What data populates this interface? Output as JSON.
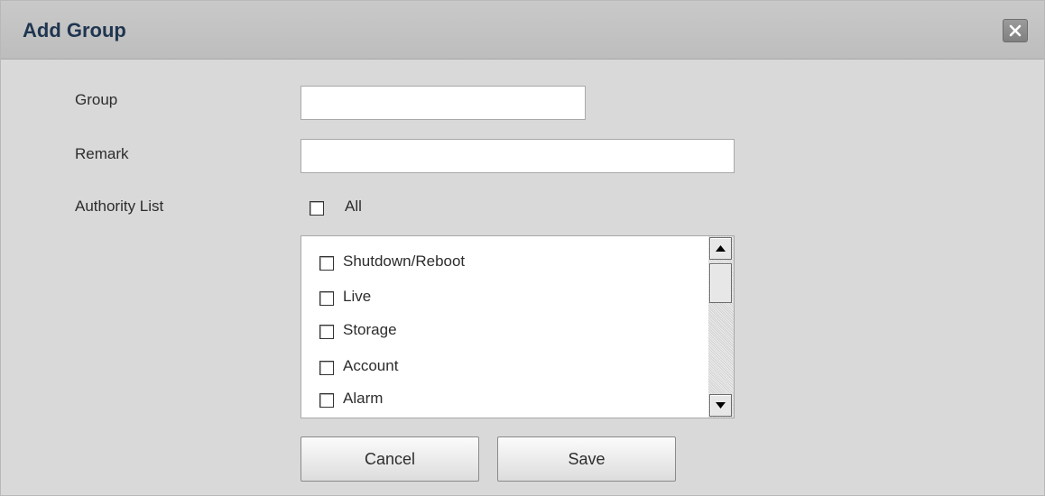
{
  "dialog": {
    "title": "Add Group",
    "close_icon": "close-x-icon"
  },
  "form": {
    "group_label": "Group",
    "group_value": "",
    "remark_label": "Remark",
    "remark_value": "",
    "authority_label": "Authority List",
    "all_label": "All",
    "all_checked": false
  },
  "authority_items": [
    {
      "label": "Shutdown/Reboot",
      "checked": false
    },
    {
      "label": "Live",
      "checked": false
    },
    {
      "label": "Storage",
      "checked": false
    },
    {
      "label": "Account",
      "checked": false
    },
    {
      "label": "Alarm",
      "checked": false
    }
  ],
  "scrollbar": {
    "up_icon": "scroll-up-arrow-icon",
    "down_icon": "scroll-down-arrow-icon"
  },
  "buttons": {
    "cancel_label": "Cancel",
    "save_label": "Save"
  },
  "colors": {
    "title_text": "#1f3550",
    "dialog_bg": "#d9d9d9",
    "titlebar_bg": "#c3c3c3"
  }
}
